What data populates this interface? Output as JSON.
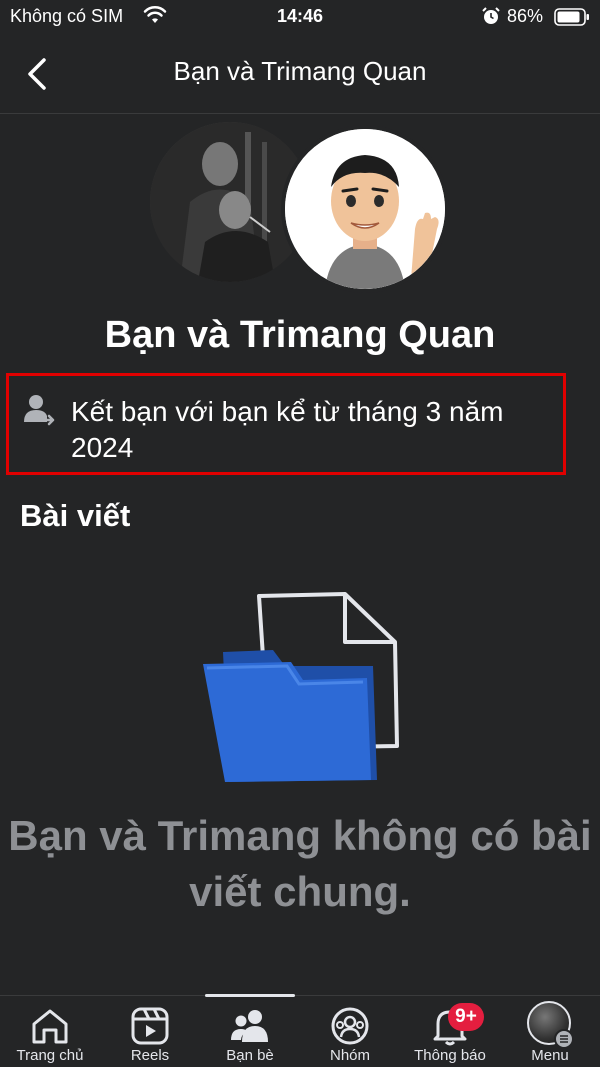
{
  "status_bar": {
    "carrier": "Không có SIM",
    "time": "14:46",
    "battery": "86%"
  },
  "nav": {
    "title": "Bạn và Trimang Quan"
  },
  "header": {
    "title": "Bạn và Trimang Quan"
  },
  "friendship": {
    "text": "Kết bạn với bạn kể từ tháng 3 năm 2024"
  },
  "posts": {
    "section_title": "Bài viết",
    "empty_message": "Bạn và Trimang không có bài viết chung."
  },
  "tabs": [
    {
      "label": "Trang chủ",
      "icon": "home-icon"
    },
    {
      "label": "Reels",
      "icon": "reels-icon"
    },
    {
      "label": "Bạn bè",
      "icon": "friends-icon",
      "active": true
    },
    {
      "label": "Nhóm",
      "icon": "groups-icon"
    },
    {
      "label": "Thông báo",
      "icon": "bell-icon",
      "badge": "9+"
    },
    {
      "label": "Menu",
      "icon": "menu-avatar"
    }
  ],
  "colors": {
    "background": "#242526",
    "highlight_border": "#e00000",
    "folder": "#2d6ad6",
    "badge": "#e41e3f"
  }
}
